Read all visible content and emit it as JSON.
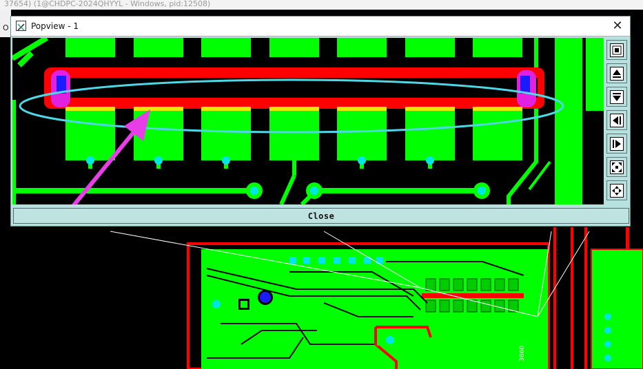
{
  "app_window": {
    "title_fragment": "37654) (1@CHDPC-2024QHYYL - Windows, pid:12508)",
    "left_char": "O"
  },
  "popview": {
    "title": "Popview - 1",
    "close_x": "✕",
    "close_button_label": "Close",
    "toolbar": [
      {
        "name": "zoom-fit-icon"
      },
      {
        "name": "pan-up-icon"
      },
      {
        "name": "pan-down-icon"
      },
      {
        "name": "pan-left-icon"
      },
      {
        "name": "pan-right-icon"
      },
      {
        "name": "zoom-in-icon"
      },
      {
        "name": "zoom-out-icon"
      }
    ]
  },
  "board_silkscreen": "3660",
  "colors": {
    "copper_green": "#00ff00",
    "trace_red": "#ff0000",
    "via_cyan": "#00e6e6",
    "highlight_cyan": "#4fd7e6",
    "arrow_magenta": "#e83ee8",
    "pad_blue": "#1b1bff",
    "popup_bg": "#b8e0de"
  }
}
